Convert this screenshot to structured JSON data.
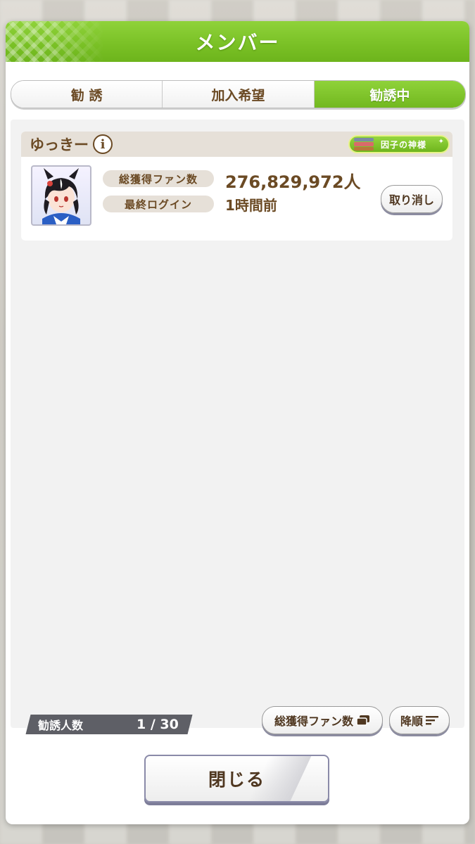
{
  "dialog": {
    "title": "メンバー",
    "tabs": [
      "勧 誘",
      "加入希望",
      "勧誘中"
    ],
    "active_tab": 2
  },
  "member": {
    "name": "ゆっきー",
    "info_icon": "info-icon",
    "badge": "因子の神様",
    "fans_label": "総獲得ファン数",
    "fans_value": "276,829,972人",
    "login_label": "最終ログイン",
    "login_value": "1時間前",
    "cancel_label": "取り消し"
  },
  "footer": {
    "count_label": "勧誘人数",
    "count_value": "1 / 30",
    "sort_field_label": "総獲得ファン数",
    "sort_order_label": "降順",
    "close_label": "閉じる"
  },
  "colors": {
    "accent_green": "#79c025",
    "text_brown": "#6b4a24",
    "label_bg": "#e6e0d8"
  }
}
